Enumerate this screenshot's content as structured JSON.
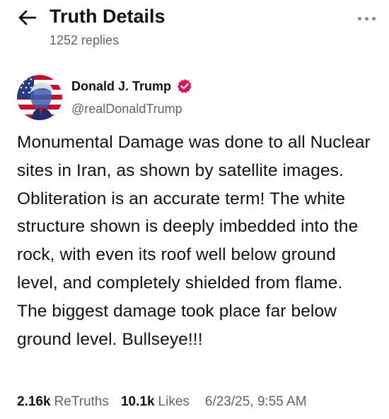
{
  "header": {
    "title": "Truth Details",
    "replies_label": "1252 replies"
  },
  "post": {
    "author": {
      "display_name": "Donald J. Trump",
      "handle": "@realDonaldTrump",
      "verified": true
    },
    "body": "Monumental Damage was done to all Nuclear sites in Iran, as shown by satellite images. Obliteration is an accurate term! The white structure shown is deeply imbedded into the rock, with even its roof well below ground level, and completely shielded from flame. The biggest damage took place far below ground level. Bullseye!!!",
    "stats": {
      "retruths_count": "2.16k",
      "retruths_label": "ReTruths",
      "likes_count": "10.1k",
      "likes_label": "Likes"
    },
    "timestamp": "6/23/25, 9:55 AM"
  },
  "icons": {
    "back": "arrow-left-icon",
    "more": "more-horizontal-icon",
    "verified": "verified-check-icon"
  },
  "colors": {
    "text_primary": "#121212",
    "text_secondary": "#636363",
    "verified_badge": "#e0115f"
  }
}
